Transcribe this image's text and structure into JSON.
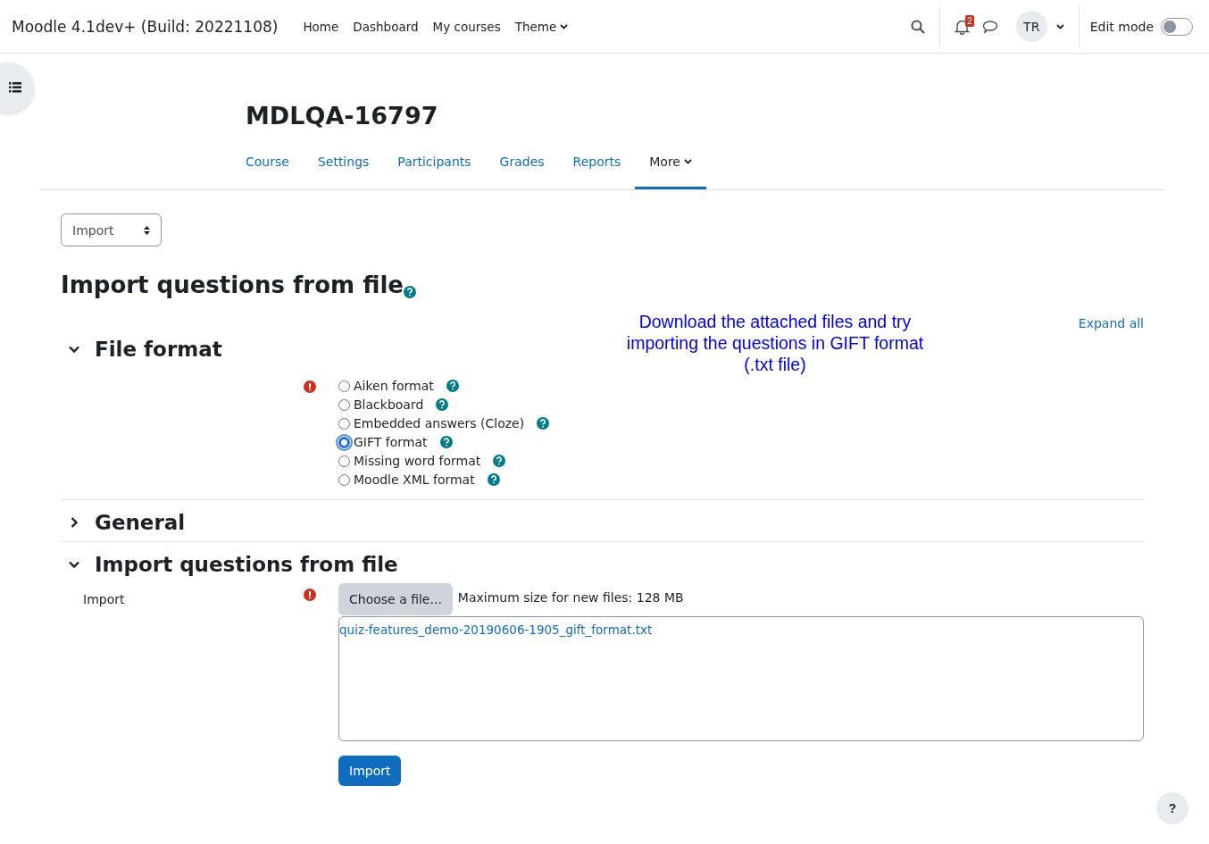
{
  "navbar": {
    "site_name": "Moodle 4.1dev+ (Build: 20221108)",
    "links": [
      {
        "label": "Home",
        "dropdown": false
      },
      {
        "label": "Dashboard",
        "dropdown": false
      },
      {
        "label": "My courses",
        "dropdown": false
      },
      {
        "label": "Theme",
        "dropdown": true
      }
    ],
    "notification_count": "2",
    "user_initials": "TR",
    "edit_mode": {
      "label": "Edit mode",
      "on": false
    }
  },
  "course": {
    "title": "MDLQA-16797",
    "tabs": [
      {
        "label": "Course",
        "selected": false,
        "dropdown": false
      },
      {
        "label": "Settings",
        "selected": false,
        "dropdown": false
      },
      {
        "label": "Participants",
        "selected": false,
        "dropdown": false
      },
      {
        "label": "Grades",
        "selected": false,
        "dropdown": false
      },
      {
        "label": "Reports",
        "selected": false,
        "dropdown": false
      },
      {
        "label": "More",
        "selected": true,
        "dropdown": true
      }
    ]
  },
  "action_select": {
    "value": "Import"
  },
  "page_heading": "Import questions from file",
  "annotation": "Download the attached files and try importing the questions in GIFT format (.txt file)",
  "expand_all": "Expand all",
  "sections": [
    {
      "title": "File format",
      "expanded": true,
      "kind": "formats",
      "options": [
        {
          "label": "Aiken format",
          "selected": false
        },
        {
          "label": "Blackboard",
          "selected": false
        },
        {
          "label": "Embedded answers (Cloze)",
          "selected": false
        },
        {
          "label": "GIFT format",
          "selected": true
        },
        {
          "label": "Missing word format",
          "selected": false
        },
        {
          "label": "Moodle XML format",
          "selected": false
        }
      ]
    },
    {
      "title": "General",
      "expanded": false,
      "kind": "general"
    },
    {
      "title": "Import questions from file",
      "expanded": true,
      "kind": "file",
      "field_label": "Import",
      "choose_button": "Choose a file...",
      "max_size": "Maximum size for new files: 128 MB",
      "files": [
        "quiz-features_demo-20190606-1905_gift_format.txt"
      ],
      "submit": "Import"
    }
  ],
  "help_button": "?"
}
